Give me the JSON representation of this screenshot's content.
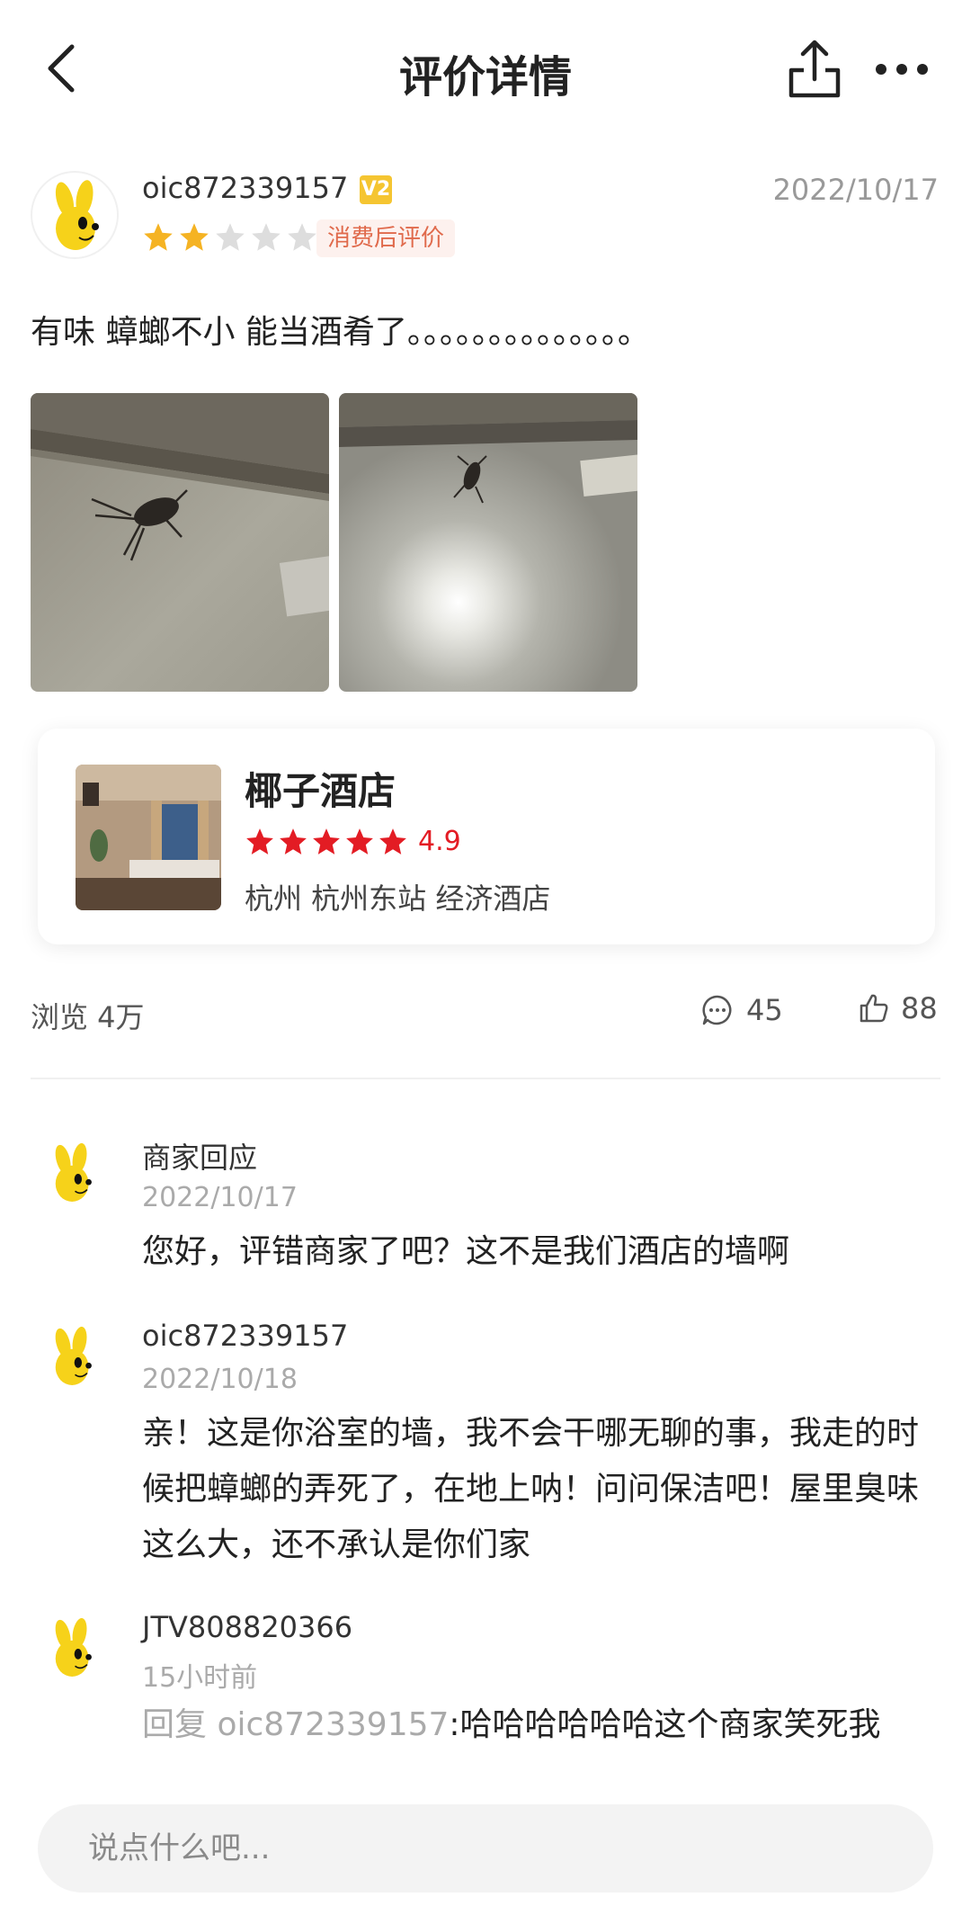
{
  "header": {
    "title": "评价详情",
    "back_icon": "chevron-left-icon",
    "share_icon": "share-icon",
    "more_icon": "more-icon"
  },
  "review": {
    "username": "oic872339157",
    "badge": "V2",
    "date": "2022/10/17",
    "rating": 2,
    "max_rating": 5,
    "tag": "消费后评价",
    "text": "有味 蟑螂不小  能当酒肴了。。。。。。。。。。。。。。",
    "photo_count": 2
  },
  "hotel": {
    "name": "椰子酒店",
    "stars": 5,
    "rating": "4.9",
    "tags": "杭州 杭州东站 经济酒店"
  },
  "stats": {
    "views": "浏览 4万",
    "comments": "45",
    "likes": "88"
  },
  "comments": [
    {
      "name": "商家回应",
      "time": "2022/10/17",
      "body": "您好，评错商家了吧？这不是我们酒店的墙啊"
    },
    {
      "name": "oic872339157",
      "time": "2022/10/18",
      "body": "亲！这是你浴室的墙，我不会干哪无聊的事，我走的时候把蟑螂的弄死了，在地上呐！问问保洁吧！屋里臭味这么大，还不承认是你们家"
    },
    {
      "name": "JTV808820366",
      "time": "15小时前",
      "reply_prefix": "回复 oic872339157",
      "body": ":哈哈哈哈哈哈这个商家笑死我"
    }
  ],
  "input": {
    "placeholder": "说点什么吧..."
  },
  "colors": {
    "star_gold": "#f5b323",
    "star_empty": "#dddddd",
    "hotel_star": "#e31c24",
    "tag_bg": "#fdf1ee",
    "tag_text": "#e06a4c"
  }
}
